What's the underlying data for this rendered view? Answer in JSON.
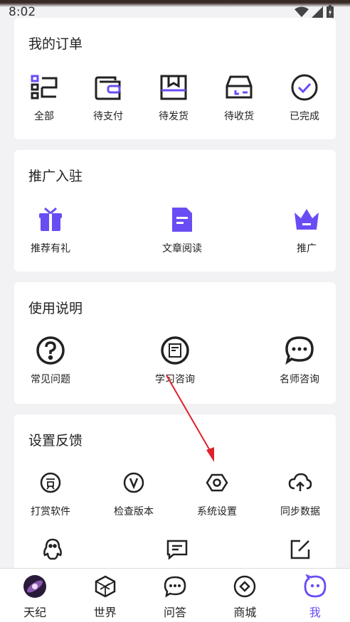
{
  "status_bar": {
    "time": "8:02"
  },
  "orders": {
    "title": "我的订单",
    "items": [
      {
        "label": "全部",
        "icon": "list-icon"
      },
      {
        "label": "待支付",
        "icon": "wallet-icon"
      },
      {
        "label": "待发货",
        "icon": "package-icon"
      },
      {
        "label": "待收货",
        "icon": "truck-box-icon"
      },
      {
        "label": "已完成",
        "icon": "check-circle-icon"
      }
    ]
  },
  "promo": {
    "title": "推广入驻",
    "items": [
      {
        "label": "推荐有礼",
        "icon": "gift-icon"
      },
      {
        "label": "文章阅读",
        "icon": "document-icon"
      },
      {
        "label": "推广",
        "icon": "crown-icon"
      }
    ]
  },
  "usage": {
    "title": "使用说明",
    "items": [
      {
        "label": "常见问题",
        "icon": "question-circle-icon"
      },
      {
        "label": "学习咨询",
        "icon": "study-consult-icon"
      },
      {
        "label": "名师咨询",
        "icon": "chat-bubble-icon"
      }
    ]
  },
  "settings": {
    "title": "设置反馈",
    "items": [
      {
        "label": "打赏软件",
        "icon": "reward-icon"
      },
      {
        "label": "检查版本",
        "icon": "version-icon"
      },
      {
        "label": "系统设置",
        "icon": "hexagon-settings-icon"
      },
      {
        "label": "同步数据",
        "icon": "cloud-sync-icon"
      },
      {
        "label": "",
        "icon": "qq-penguin-icon"
      },
      {
        "label": "",
        "icon": "message-icon"
      },
      {
        "label": "",
        "icon": "edit-icon"
      }
    ]
  },
  "tabbar": {
    "tabs": [
      {
        "label": "天纪",
        "icon": "galaxy-avatar-icon"
      },
      {
        "label": "世界",
        "icon": "cube-icon"
      },
      {
        "label": "问答",
        "icon": "chat-dots-icon"
      },
      {
        "label": "商城",
        "icon": "shop-icon"
      },
      {
        "label": "我",
        "icon": "me-face-icon",
        "active": true
      }
    ]
  },
  "colors": {
    "accent": "#6a4cf5",
    "arrow": "#e0202a"
  }
}
